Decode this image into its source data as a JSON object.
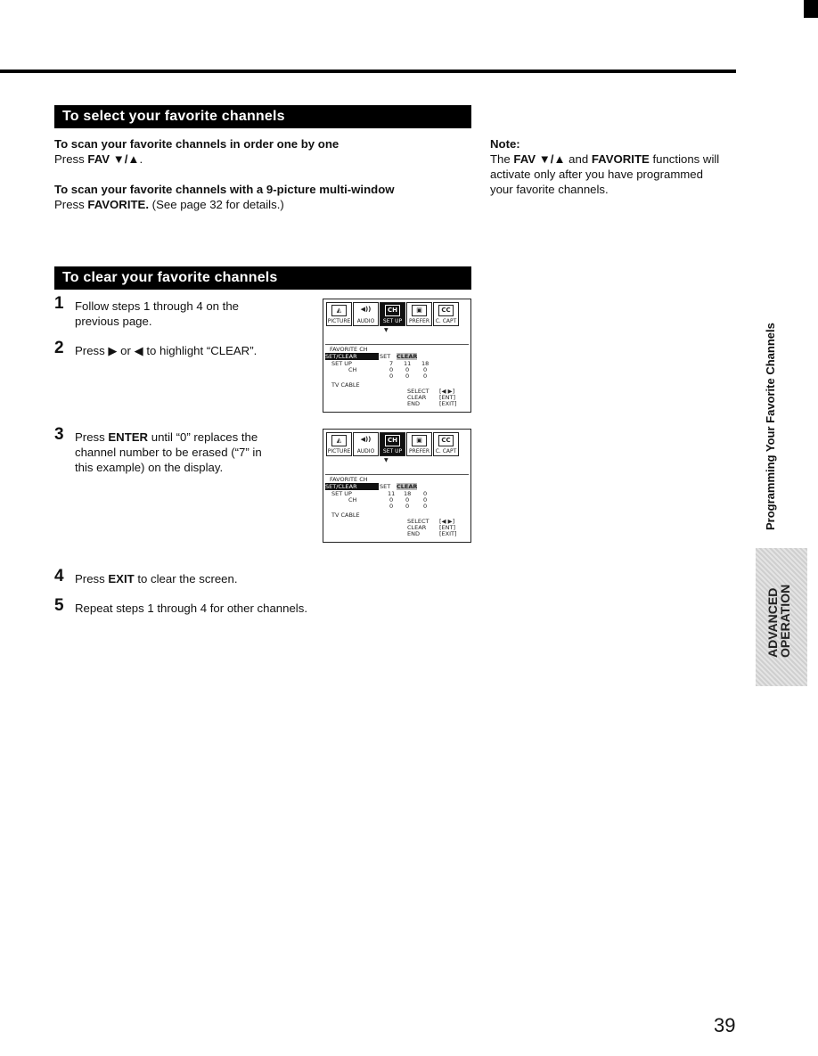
{
  "page": {
    "page_number": "39",
    "side_title": "Programming Your Favorite Channels",
    "side_tab": [
      "ADVANCED",
      "OPERATION"
    ]
  },
  "select_section": {
    "title": "To select your favorite channels",
    "items": [
      {
        "heading": "To scan your favorite channels in order one by one",
        "prefix": "Press ",
        "key": "FAV ▼/▲",
        "suffix": "."
      },
      {
        "heading": "To scan your favorite channels with a 9-picture multi-window",
        "prefix": "Press ",
        "key": "FAVORITE.",
        "suffix": " (See page 32 for details.)"
      }
    ]
  },
  "note": {
    "title": "Note:",
    "parts": [
      "The ",
      "FAV ▼/▲",
      " and ",
      "FAVORITE",
      " functions will"
    ],
    "line2": "activate only after you have programmed",
    "line3": "your favorite channels."
  },
  "clear_section": {
    "title": "To clear your favorite channels",
    "steps": [
      {
        "num": "1",
        "lines": [
          "Follow steps 1 through 4 on the",
          "previous page."
        ]
      },
      {
        "num": "2",
        "text": "Press ▶ or ◀ to highlight “CLEAR”."
      },
      {
        "num": "3",
        "prefix": "Press ",
        "key": "ENTER",
        "suffix": " until “0” replaces the",
        "lines": [
          "channel number to be erased (“7” in",
          "this example) on the display."
        ]
      },
      {
        "num": "4",
        "prefix": "Press ",
        "key": "EXIT",
        "suffix": " to clear the screen."
      },
      {
        "num": "5",
        "text": "Repeat steps 1 through 4 for other channels."
      }
    ]
  },
  "osd": {
    "tabs": [
      {
        "label": "PICTURE",
        "icon": "picture-icon",
        "glyph": "◭"
      },
      {
        "label": "AUDIO",
        "icon": "speaker-icon",
        "glyph": "◀))"
      },
      {
        "label": "SET UP",
        "icon": "tv-ch-icon",
        "glyph": "CH"
      },
      {
        "label": "PREFER",
        "icon": "camera-icon",
        "glyph": "▣"
      },
      {
        "label": "C. CAPT",
        "icon": "cc-icon",
        "glyph": "CC"
      }
    ],
    "menu_title": "FAVORITE CH",
    "row_label": "SET/CLEAR",
    "opt_set": "SET",
    "opt_clear": "CLEAR",
    "setup_label": "SET UP",
    "ch_label": "CH",
    "tv_cable": "TV CABLE",
    "help": [
      {
        "label": "SELECT",
        "key": "[◀ ▶]"
      },
      {
        "label": "CLEAR",
        "key": "[ENT]"
      },
      {
        "label": "END",
        "key": "[EXIT]"
      }
    ],
    "screen1_values": [
      [
        "7",
        "11",
        "18"
      ],
      [
        "0",
        "0",
        "0"
      ],
      [
        "0",
        "0",
        "0"
      ]
    ],
    "screen2_values": [
      [
        "11",
        "18",
        "0"
      ],
      [
        "0",
        "0",
        "0"
      ],
      [
        "0",
        "0",
        "0"
      ]
    ]
  }
}
